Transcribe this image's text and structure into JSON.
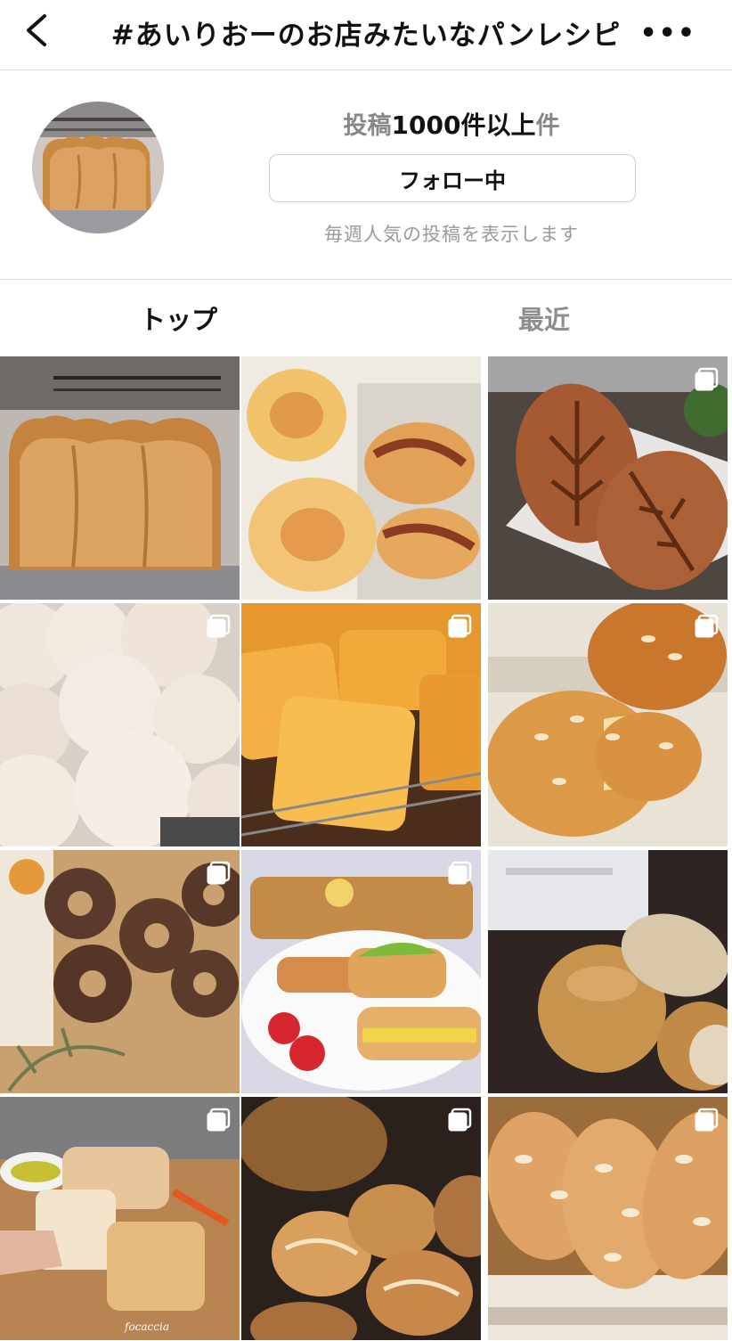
{
  "header": {
    "title": "#あいりおーのお店みたいなパンレシピ"
  },
  "profile": {
    "count_prefix": "投稿",
    "count_value": "1000件以上",
    "count_suffix": "件",
    "follow_label": "フォロー中",
    "hint": "毎週人気の投稿を表示します"
  },
  "tabs": [
    {
      "label": "トップ"
    },
    {
      "label": "最近"
    }
  ],
  "grid": {
    "posts": [
      {
        "name": "loaf-bread-post",
        "multi": false
      },
      {
        "name": "twisted-bread-post",
        "multi": false
      },
      {
        "name": "leaf-fougasse-post",
        "multi": true
      },
      {
        "name": "white-rolls-post",
        "multi": true
      },
      {
        "name": "golden-cubes-post",
        "multi": true
      },
      {
        "name": "almond-bun-post",
        "multi": true
      },
      {
        "name": "chocolate-donut-post",
        "multi": true
      },
      {
        "name": "sandwich-plate-post",
        "multi": true
      },
      {
        "name": "round-bread-post",
        "multi": false
      },
      {
        "name": "focaccia-post",
        "multi": true,
        "caption": "focaccia"
      },
      {
        "name": "crusty-rolls-post",
        "multi": true
      },
      {
        "name": "almond-loaves-post",
        "multi": true
      }
    ]
  }
}
